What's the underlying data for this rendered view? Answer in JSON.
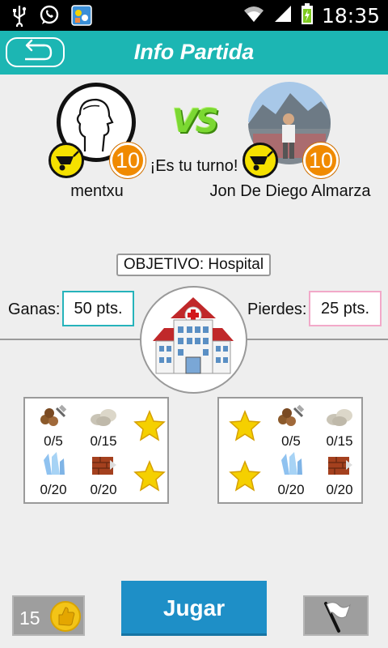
{
  "status_bar": {
    "time": "18:35",
    "icons": [
      "usb-icon",
      "whatsapp-icon",
      "app-notification-icon",
      "wifi-icon",
      "signal-icon",
      "battery-charging-icon"
    ]
  },
  "header": {
    "title": "Info Partida",
    "back_icon": "back-arrow-icon",
    "color": "#1cb6b3"
  },
  "match": {
    "vs_label": "VS",
    "turn_text": "¡Es tu turno!",
    "player_left": {
      "name": "mentxu",
      "level": "10",
      "avatar": "silhouette-avatar"
    },
    "player_right": {
      "name": "Jon De Diego Almarza",
      "level": "10",
      "avatar": "photo-avatar"
    }
  },
  "objective": {
    "text": "OBJETIVO: Hospital",
    "building_icon": "hospital-icon"
  },
  "scoring": {
    "win_label": "Ganas:",
    "win_value": "50 pts.",
    "lose_label": "Pierdes:",
    "lose_value": "25 pts."
  },
  "resources_left": [
    {
      "icon": "wood-icon",
      "count": "0/5"
    },
    {
      "icon": "stone-icon",
      "count": "0/15"
    },
    {
      "icon": "crystal-icon",
      "count": "0/20"
    },
    {
      "icon": "brick-icon",
      "count": "0/20"
    }
  ],
  "resources_right": [
    {
      "icon": "wood-icon",
      "count": "0/5"
    },
    {
      "icon": "stone-icon",
      "count": "0/15"
    },
    {
      "icon": "crystal-icon",
      "count": "0/20"
    },
    {
      "icon": "brick-icon",
      "count": "0/20"
    }
  ],
  "bottom": {
    "coins": "15",
    "play_label": "Jugar",
    "play_color": "#1e8fc7",
    "flag_icon": "surrender-flag-icon"
  }
}
